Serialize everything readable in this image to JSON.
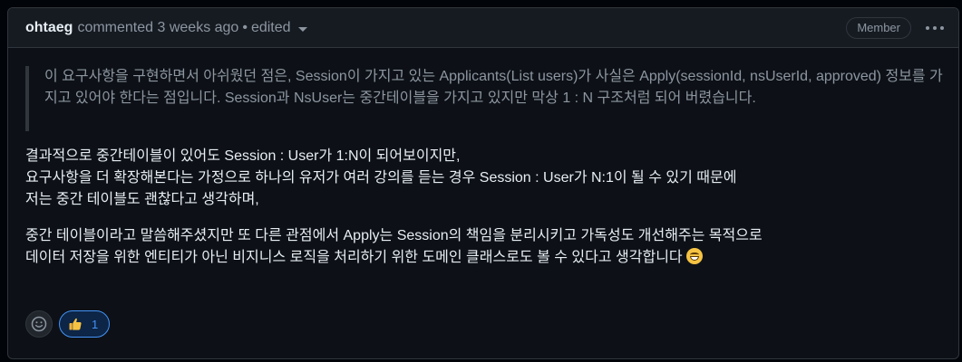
{
  "header": {
    "author": "ohtaeg",
    "action_text": "commented 3 weeks ago",
    "separator": "•",
    "edited_label": "edited",
    "role_badge": "Member"
  },
  "body": {
    "quote": "이 요구사항을 구현하면서 아쉬웠던 점은, Session이 가지고 있는 Applicants(List users)가 사실은 Apply(sessionId, nsUserId, approved) 정보를 가지고 있어야 한다는 점입니다. Session과 NsUser는 중간테이블을 가지고 있지만 막상 1 : N 구조처럼 되어 버렸습니다.",
    "paragraph1": {
      "line1": "결과적으로 중간테이블이 있어도 Session : User가 1:N이 되어보이지만,",
      "line2": "요구사항을 더 확장해본다는 가정으로 하나의 유저가 여러 강의를 듣는 경우 Session : User가 N:1이 될 수 있기 때문에",
      "line3": "저는 중간 테이블도 괜찮다고 생각하며,"
    },
    "paragraph2": {
      "line1": "중간 테이블이라고 말씀해주셨지만 또 다른 관점에서 Apply는 Session의 책임을 분리시키고 가독성도 개선해주는 목적으로",
      "line2": "데이터 저장을 위한 엔티티가 아닌 비지니스 로직을 처리하기 위한 도메인 클래스로도 볼 수 있다고 생각합니다",
      "emoji": "smile-emoji"
    }
  },
  "reactions": {
    "add_icon": "smiley-icon",
    "items": [
      {
        "icon": "thumbs-up-emoji",
        "count": "1"
      }
    ]
  },
  "colors": {
    "page_bg": "#010409",
    "comment_bg": "#0d1117",
    "header_bg": "#161b22",
    "border": "#30363d",
    "muted_text": "#8d96a0",
    "text": "#e6edf3",
    "accent": "#4493f8"
  }
}
